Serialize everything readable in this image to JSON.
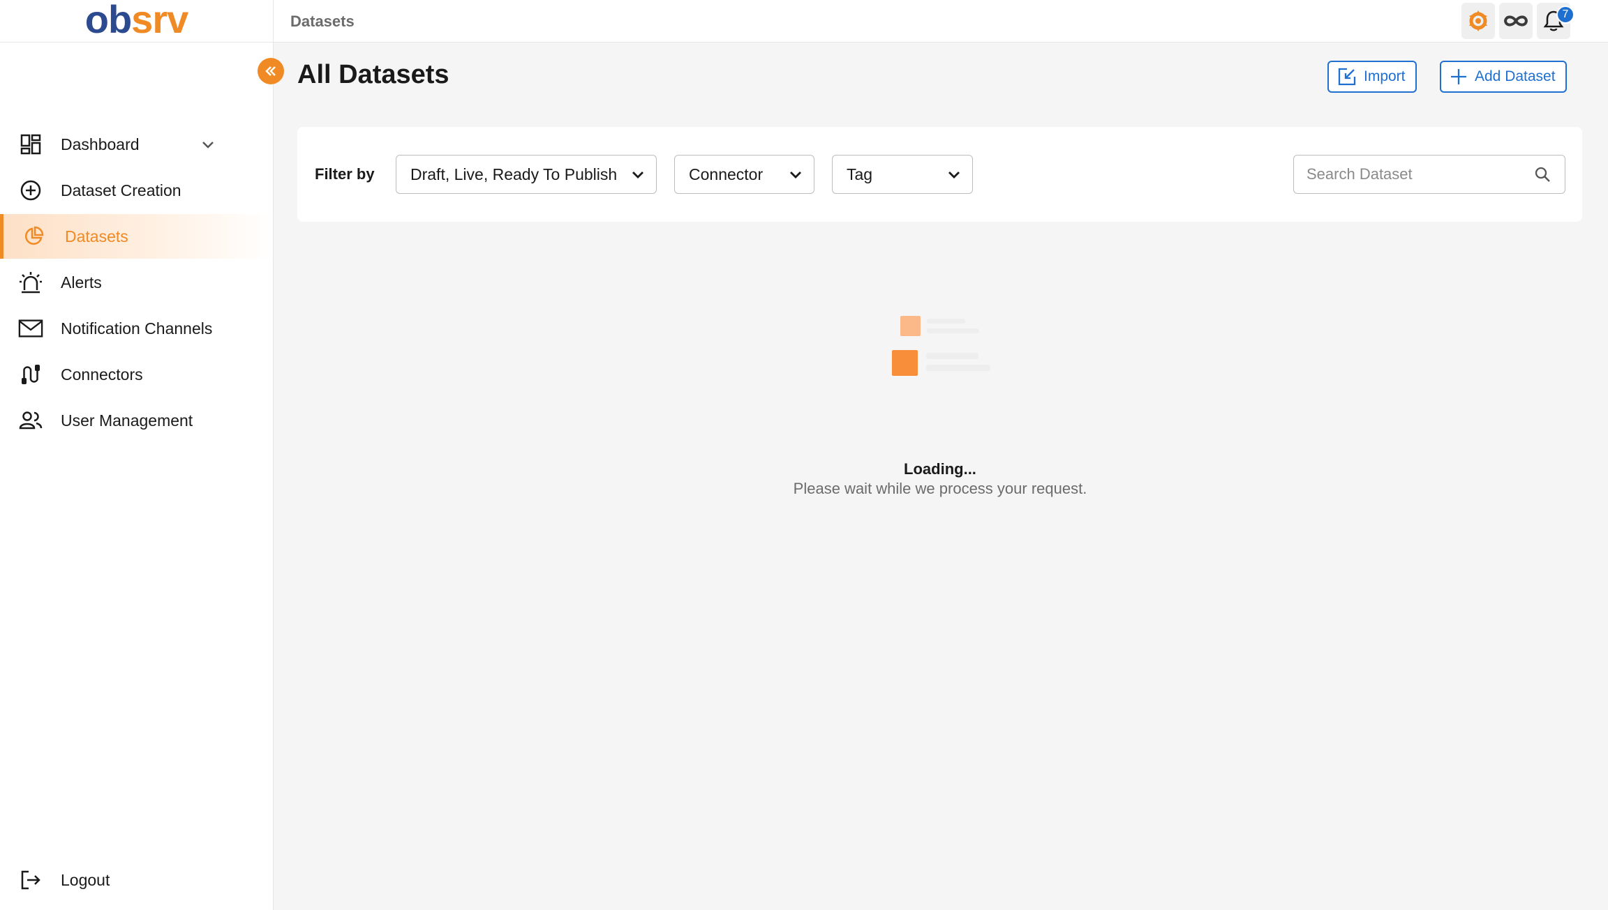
{
  "app": {
    "logo_parts": [
      "o",
      "b",
      "s",
      "r",
      "v"
    ],
    "breadcrumb": "Datasets",
    "notification_count": "7"
  },
  "colors": {
    "accent": "#f08a24",
    "primary_blue": "#1f6fd1",
    "logo_blue": "#2c4a8f"
  },
  "topbar_icons": [
    "grafana-icon",
    "infinity-icon",
    "bell-icon"
  ],
  "sidebar": {
    "items": [
      {
        "label": "Dashboard",
        "icon": "dashboard-icon",
        "has_chevron": true
      },
      {
        "label": "Dataset Creation",
        "icon": "plus-circle-icon"
      },
      {
        "label": "Datasets",
        "icon": "datasets-icon",
        "active": true
      },
      {
        "label": "Alerts",
        "icon": "siren-icon"
      },
      {
        "label": "Notification Channels",
        "icon": "mail-icon"
      },
      {
        "label": "Connectors",
        "icon": "connector-icon"
      },
      {
        "label": "User Management",
        "icon": "users-icon"
      }
    ],
    "logout_label": "Logout"
  },
  "main": {
    "title": "All Datasets",
    "import_label": "Import",
    "add_label": "Add Dataset",
    "filter": {
      "label": "Filter by",
      "status_value": "Draft, Live, Ready To Publish",
      "connector_value": "Connector",
      "tag_value": "Tag",
      "search_placeholder": "Search Dataset"
    },
    "loading": {
      "title": "Loading...",
      "message": "Please wait while we process your request."
    }
  }
}
